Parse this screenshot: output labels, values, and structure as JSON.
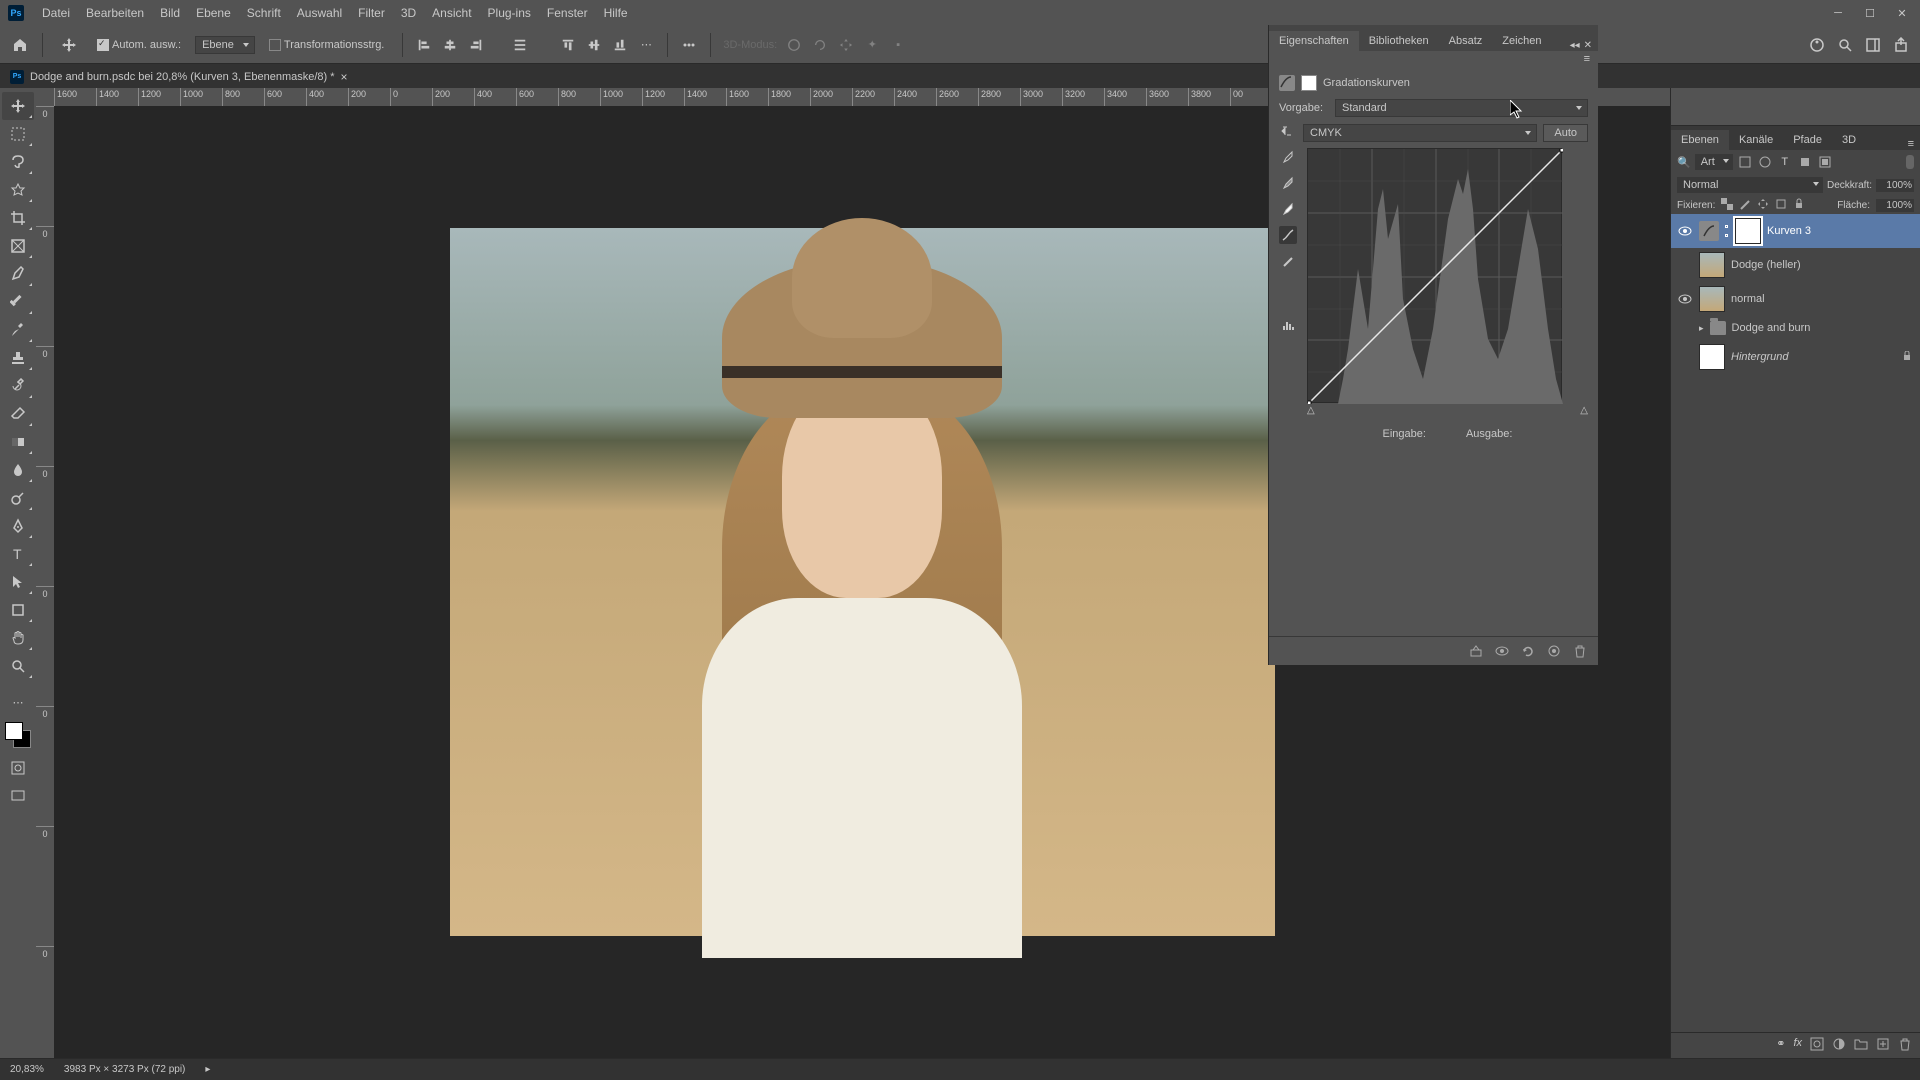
{
  "menus": [
    "Datei",
    "Bearbeiten",
    "Bild",
    "Ebene",
    "Schrift",
    "Auswahl",
    "Filter",
    "3D",
    "Ansicht",
    "Plug-ins",
    "Fenster",
    "Hilfe"
  ],
  "options": {
    "autoselect_label": "Autom. ausw.:",
    "autoselect_value": "Ebene",
    "transform_label": "Transformationsstrg.",
    "mode3d_label": "3D-Modus:"
  },
  "doctab": {
    "title": "Dodge and burn.psdc bei 20,8% (Kurven 3, Ebenenmaske/8) *"
  },
  "ruler_top": [
    "1600",
    "1400",
    "1200",
    "1000",
    "800",
    "600",
    "400",
    "200",
    "0",
    "200",
    "400",
    "600",
    "800",
    "1000",
    "1200",
    "1400",
    "1600",
    "1800",
    "2000",
    "2200",
    "2400",
    "2600",
    "2800",
    "3000",
    "3200",
    "3400",
    "3600",
    "3800",
    "00"
  ],
  "ruler_left": [
    "0",
    "0",
    "0",
    "0",
    "0",
    "0",
    "0",
    "0"
  ],
  "properties": {
    "tabs": [
      "Eigenschaften",
      "Bibliotheken",
      "Absatz",
      "Zeichen"
    ],
    "adj_name": "Gradationskurven",
    "preset_label": "Vorgabe:",
    "preset_value": "Standard",
    "channel_value": "CMYK",
    "auto_btn": "Auto",
    "input_label": "Eingabe:",
    "output_label": "Ausgabe:"
  },
  "layers": {
    "tabs": [
      "Ebenen",
      "Kanäle",
      "Pfade",
      "3D"
    ],
    "filter_kind": "Art",
    "blend_mode": "Normal",
    "opacity_label": "Deckkraft:",
    "opacity_value": "100%",
    "lock_label": "Fixieren:",
    "fill_label": "Fläche:",
    "fill_value": "100%",
    "items": [
      {
        "name": "Kurven 3",
        "visible": true,
        "selected": true,
        "type": "adj"
      },
      {
        "name": "Dodge (heller)",
        "visible": false,
        "type": "layer"
      },
      {
        "name": "normal",
        "visible": true,
        "type": "layer"
      },
      {
        "name": "Dodge and burn",
        "visible": false,
        "type": "group"
      },
      {
        "name": "Hintergrund",
        "visible": false,
        "type": "bg",
        "locked": true
      }
    ]
  },
  "status": {
    "zoom": "20,83%",
    "dims": "3983 Px × 3273 Px (72 ppi)"
  },
  "chart_data": null
}
